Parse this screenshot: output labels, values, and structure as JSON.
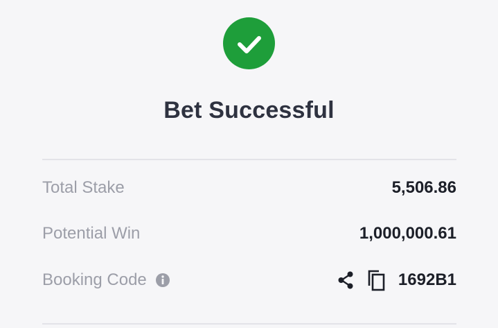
{
  "status": {
    "icon": "check-circle-icon",
    "color": "#1e9e3a",
    "title": "Bet Successful"
  },
  "summary": {
    "total_stake": {
      "label": "Total Stake",
      "value": "5,506.86"
    },
    "potential_win": {
      "label": "Potential Win",
      "value": "1,000,000.61"
    },
    "booking_code": {
      "label": "Booking Code",
      "info_icon": "info-icon",
      "share_icon": "share-icon",
      "copy_icon": "copy-icon",
      "value": "1692B1"
    }
  }
}
